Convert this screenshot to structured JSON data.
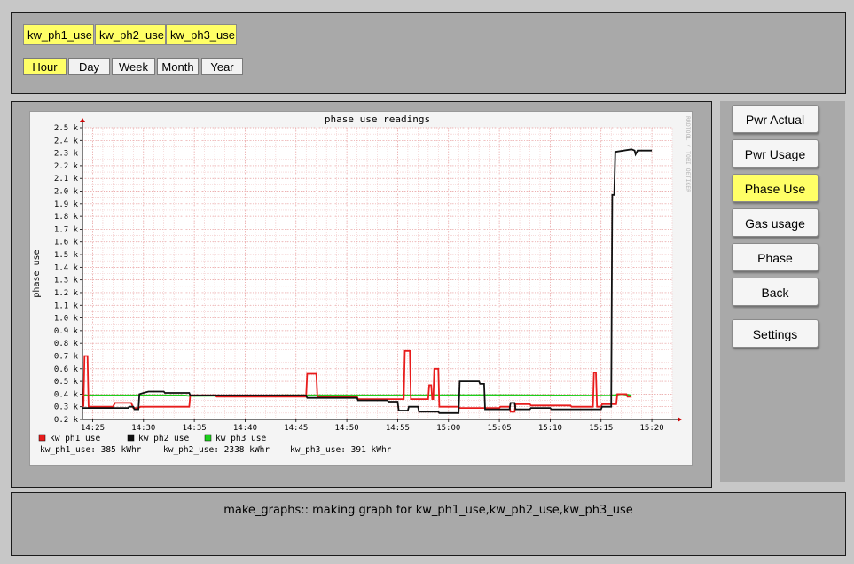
{
  "variables": [
    "kw_ph1_use",
    "kw_ph2_use",
    "kw_ph3_use"
  ],
  "periods": [
    {
      "label": "Hour",
      "active": true
    },
    {
      "label": "Day",
      "active": false
    },
    {
      "label": "Week",
      "active": false
    },
    {
      "label": "Month",
      "active": false
    },
    {
      "label": "Year",
      "active": false
    }
  ],
  "sidebar": [
    {
      "label": "Pwr Actual",
      "active": false
    },
    {
      "label": "Pwr Usage",
      "active": false
    },
    {
      "label": "Phase Use",
      "active": true
    },
    {
      "label": "Gas usage",
      "active": false
    },
    {
      "label": "Phase",
      "active": false
    },
    {
      "label": "Back",
      "active": false
    },
    {
      "label": "Settings",
      "active": false
    }
  ],
  "status_message": "make_graphs:: making graph for kw_ph1_use,kw_ph2_use,kw_ph3_use",
  "colors": {
    "ph1": "#e81c1c",
    "ph2": "#111111",
    "ph3": "#1ccf1c",
    "accent": "#ffff66"
  },
  "chart_data": {
    "type": "line",
    "title": "phase use readings",
    "ylabel": "phase use",
    "watermark": "RRDTOOL / TOBI OETIKER",
    "y_tick_labels": [
      "0.2 k",
      "0.3 k",
      "0.4 k",
      "0.5 k",
      "0.6 k",
      "0.7 k",
      "0.8 k",
      "0.9 k",
      "1.0 k",
      "1.1 k",
      "1.2 k",
      "1.3 k",
      "1.4 k",
      "1.5 k",
      "1.6 k",
      "1.7 k",
      "1.8 k",
      "1.9 k",
      "2.0 k",
      "2.1 k",
      "2.2 k",
      "2.3 k",
      "2.4 k",
      "2.5 k"
    ],
    "x_tick_labels": [
      "14:25",
      "14:30",
      "14:35",
      "14:40",
      "14:45",
      "14:50",
      "14:55",
      "15:00",
      "15:05",
      "15:10",
      "15:15",
      "15:20"
    ],
    "ylim": [
      200,
      2500
    ],
    "xlim_minutes_after_1424": [
      0,
      58
    ],
    "grid": true,
    "series": [
      {
        "name": "kw_ph1_use",
        "color": "#e81c1c",
        "summary": "kw_ph1_use: 385 kWhr",
        "points": [
          [
            0.1,
            300
          ],
          [
            0.2,
            700
          ],
          [
            0.5,
            700
          ],
          [
            0.6,
            300
          ],
          [
            3,
            300
          ],
          [
            3.2,
            330
          ],
          [
            4.8,
            330
          ],
          [
            5,
            290
          ],
          [
            5.5,
            290
          ],
          [
            5.7,
            300
          ],
          [
            10.5,
            300
          ],
          [
            10.6,
            390
          ],
          [
            13,
            390
          ],
          [
            13.2,
            380
          ],
          [
            22,
            380
          ],
          [
            22.1,
            560
          ],
          [
            23,
            560
          ],
          [
            23.1,
            380
          ],
          [
            27,
            380
          ],
          [
            27.1,
            360
          ],
          [
            30,
            360
          ],
          [
            30.1,
            360
          ],
          [
            31.6,
            360
          ],
          [
            31.7,
            740
          ],
          [
            32.2,
            740
          ],
          [
            32.3,
            360
          ],
          [
            34,
            360
          ],
          [
            34.1,
            470
          ],
          [
            34.3,
            470
          ],
          [
            34.4,
            360
          ],
          [
            34.5,
            360
          ],
          [
            34.6,
            600
          ],
          [
            35,
            600
          ],
          [
            35.1,
            300
          ],
          [
            37,
            300
          ],
          [
            37.1,
            290
          ],
          [
            41,
            290
          ],
          [
            41.1,
            300
          ],
          [
            42,
            300
          ],
          [
            42.1,
            260
          ],
          [
            42.5,
            260
          ],
          [
            42.6,
            320
          ],
          [
            44,
            320
          ],
          [
            44.1,
            310
          ],
          [
            48,
            310
          ],
          [
            48.1,
            300
          ],
          [
            50.2,
            300
          ],
          [
            50.3,
            570
          ],
          [
            50.5,
            570
          ],
          [
            50.6,
            300
          ],
          [
            51,
            300
          ],
          [
            51.1,
            320
          ],
          [
            52.5,
            320
          ],
          [
            52.6,
            400
          ],
          [
            53.5,
            400
          ],
          [
            53.6,
            380
          ],
          [
            54,
            380
          ]
        ]
      },
      {
        "name": "kw_ph2_use",
        "color": "#111111",
        "summary": "kw_ph2_use: 2338 kWhr",
        "points": [
          [
            0,
            290
          ],
          [
            4.5,
            290
          ],
          [
            4.6,
            300
          ],
          [
            5,
            300
          ],
          [
            5.1,
            280
          ],
          [
            5.5,
            280
          ],
          [
            5.6,
            400
          ],
          [
            6,
            410
          ],
          [
            6.5,
            420
          ],
          [
            8,
            420
          ],
          [
            8.1,
            410
          ],
          [
            10.5,
            410
          ],
          [
            10.6,
            390
          ],
          [
            22,
            390
          ],
          [
            22.1,
            370
          ],
          [
            27,
            370
          ],
          [
            27.1,
            350
          ],
          [
            30,
            350
          ],
          [
            30.1,
            340
          ],
          [
            31,
            340
          ],
          [
            31.1,
            270
          ],
          [
            32,
            270
          ],
          [
            32.1,
            300
          ],
          [
            33,
            300
          ],
          [
            33.1,
            260
          ],
          [
            35,
            260
          ],
          [
            35.1,
            250
          ],
          [
            37,
            250
          ],
          [
            37.1,
            500
          ],
          [
            39,
            500
          ],
          [
            39.1,
            480
          ],
          [
            39.5,
            480
          ],
          [
            39.6,
            280
          ],
          [
            42,
            280
          ],
          [
            42.1,
            330
          ],
          [
            42.5,
            330
          ],
          [
            42.6,
            280
          ],
          [
            44,
            280
          ],
          [
            44.1,
            290
          ],
          [
            46,
            290
          ],
          [
            46.1,
            280
          ],
          [
            51,
            280
          ],
          [
            51.1,
            300
          ],
          [
            52,
            300
          ],
          [
            52.1,
            1970
          ],
          [
            52.3,
            1970
          ],
          [
            52.4,
            2310
          ],
          [
            54,
            2330
          ],
          [
            54.3,
            2320
          ],
          [
            54.4,
            2290
          ],
          [
            54.6,
            2320
          ],
          [
            56,
            2320
          ]
        ]
      },
      {
        "name": "kw_ph3_use",
        "color": "#1ccf1c",
        "summary": "kw_ph3_use: 391 kWhr",
        "points": [
          [
            0,
            390
          ],
          [
            10,
            390
          ],
          [
            10.5,
            385
          ],
          [
            20,
            390
          ],
          [
            30,
            390
          ],
          [
            40,
            392
          ],
          [
            52,
            388
          ],
          [
            53,
            400
          ],
          [
            54,
            390
          ]
        ]
      }
    ]
  }
}
